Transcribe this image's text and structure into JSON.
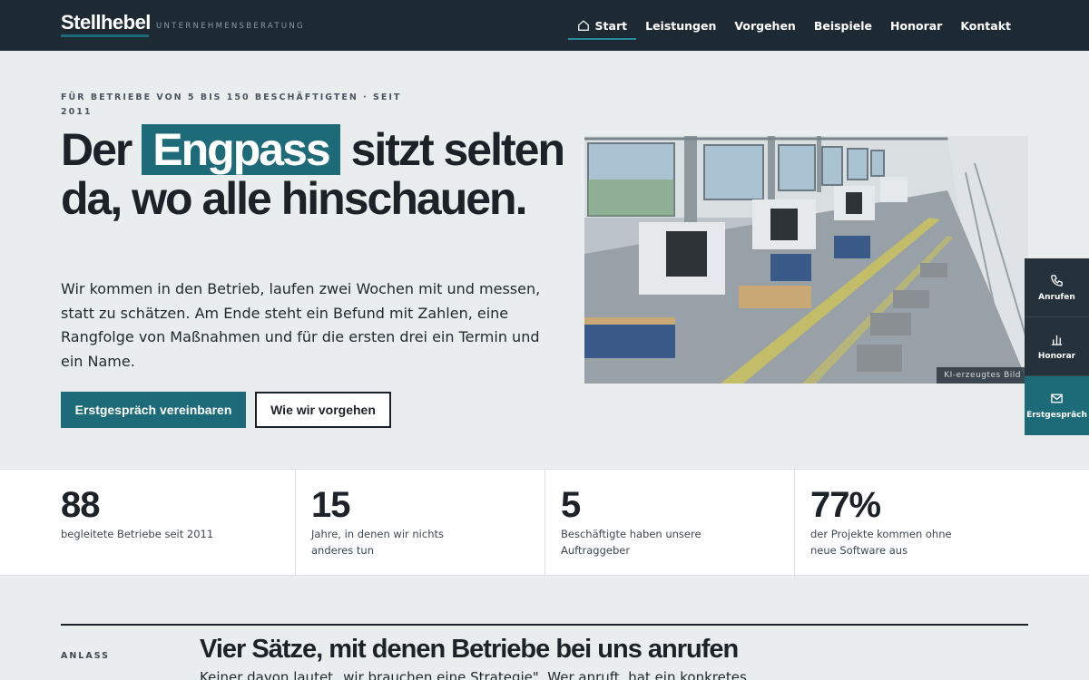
{
  "header": {
    "logo": "Stellhebel",
    "tagline": "UNTERNEHMENSBERATUNG",
    "nav": [
      {
        "label": "Start",
        "icon": "home-icon",
        "active": true
      },
      {
        "label": "Leistungen"
      },
      {
        "label": "Vorgehen"
      },
      {
        "label": "Beispiele"
      },
      {
        "label": "Honorar"
      },
      {
        "label": "Kontakt"
      }
    ]
  },
  "hero": {
    "eyebrow": "FÜR BETRIEBE VON 5 BIS 150 BESCHÄFTIGTEN · SEIT 2011",
    "headline": {
      "part1": "Der",
      "highlight": "Engpass",
      "part2": "sitzt selten da, wo alle hinschauen."
    },
    "lede": "Wir kommen in den Betrieb, laufen zwei Wochen mit und messen, statt zu schätzen. Am Ende steht ein Befund mit Zahlen, eine Rangfolge von Maßnahmen und für die ersten drei ein Termin und ein Name.",
    "primary_cta": "Erstgespräch vereinbaren",
    "secondary_cta": "Wie wir vorgehen",
    "image_credit": "KI-erzeugtes Bild"
  },
  "side_rail": [
    {
      "label": "Anrufen",
      "icon": "phone-icon"
    },
    {
      "label": "Honorar",
      "icon": "bar-chart-icon"
    },
    {
      "label": "Erstgespräch",
      "icon": "mail-icon"
    }
  ],
  "stats": [
    {
      "value": "88",
      "label": "begleitete Betriebe seit 2011"
    },
    {
      "value": "15",
      "label": "Jahre, in denen wir nichts anderes tun"
    },
    {
      "value": "5",
      "label": "Beschäftigte haben unsere Auftraggeber"
    },
    {
      "value": "77%",
      "label": "der Projekte kommen ohne neue Software aus"
    }
  ],
  "anlass": {
    "label": "ANLASS",
    "title": "Vier Sätze, mit denen Betriebe bei uns anrufen",
    "subtitle": "Keiner davon lautet „wir brauchen eine Strategie\". Wer anruft, hat ein konkretes"
  },
  "colors": {
    "brand_teal": "#1d6b78",
    "header_bg": "#1e2a33",
    "page_bg": "#eaedee"
  }
}
